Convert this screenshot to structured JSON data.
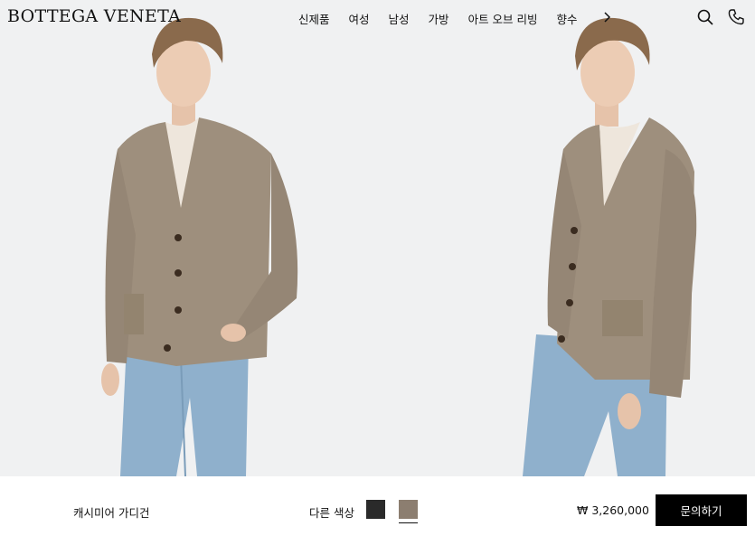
{
  "header": {
    "logo": "BOTTEGA VENETA",
    "nav": [
      {
        "label": "신제품"
      },
      {
        "label": "여성"
      },
      {
        "label": "남성"
      },
      {
        "label": "가방"
      },
      {
        "label": "아트 오브 리빙"
      },
      {
        "label": "향수"
      }
    ],
    "icons": [
      "chevron-right-icon",
      "search-icon",
      "phone-icon"
    ]
  },
  "product": {
    "name": "캐시미어 가디건",
    "other_colors_label": "다른 색상",
    "colors": [
      {
        "name": "dark-grey",
        "hex": "#2a2a2a",
        "selected": false
      },
      {
        "name": "taupe",
        "hex": "#8c7e70",
        "selected": true
      }
    ],
    "price": "₩ 3,260,000",
    "inquire_label": "문의하기"
  },
  "theme": {
    "background": "#f0f1f2",
    "bar_background": "#ffffff",
    "button_background": "#000000"
  }
}
